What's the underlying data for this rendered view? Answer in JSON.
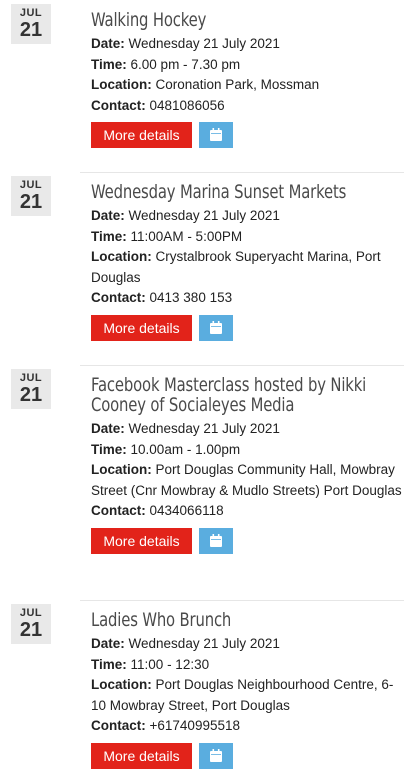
{
  "labels": {
    "date": "Date:",
    "time": "Time:",
    "location": "Location:",
    "contact": "Contact:",
    "more_details": "More details"
  },
  "icons": {
    "calendar": "calendar-icon"
  },
  "colors": {
    "more_button": "#e2231a",
    "calendar_button": "#5aaddf",
    "date_badge": "#e9e9e9"
  },
  "events": [
    {
      "month": "JUL",
      "day": "21",
      "title": "Walking Hockey",
      "date": "Wednesday 21 July 2021",
      "time": "6.00 pm - 7.30 pm",
      "location": "Coronation Park, Mossman",
      "contact": "0481086056"
    },
    {
      "month": "JUL",
      "day": "21",
      "title": "Wednesday Marina Sunset Markets",
      "date": "Wednesday 21 July 2021",
      "time": "11:00AM - 5:00PM",
      "location": "Crystalbrook Superyacht Marina, Port Douglas",
      "contact": "0413 380 153"
    },
    {
      "month": "JUL",
      "day": "21",
      "title": "Facebook Masterclass hosted by Nikki Cooney of Socialeyes Media",
      "date": "Wednesday 21 July 2021",
      "time": "10.00am - 1.00pm",
      "location": "Port Douglas Community Hall, Mowbray Street (Cnr Mowbray & Mudlo Streets) Port Douglas",
      "contact": "0434066118"
    },
    {
      "month": "JUL",
      "day": "21",
      "title": "Ladies Who Brunch",
      "date": "Wednesday 21 July 2021",
      "time": "11:00 - 12:30",
      "location": "Port Douglas Neighbourhood Centre, 6-10 Mowbray Street, Port Douglas",
      "contact": "+61740995518"
    }
  ]
}
